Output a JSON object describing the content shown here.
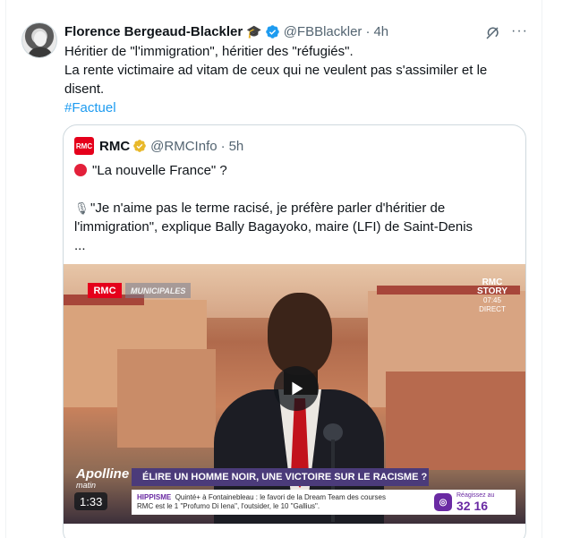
{
  "tweet": {
    "author_name": "Florence Bergeaud-Blackler",
    "author_emoji": "🎓",
    "handle": "@FBBlackler",
    "separator": "·",
    "time": "4h",
    "lines": [
      "Héritier de \"l'immigration\", héritier des \"réfugiés\".",
      "La rente victimaire ad vitam de ceux qui ne veulent pas s'assimiler et le",
      "disent."
    ],
    "hashtag": "#Factuel",
    "more_label": "···"
  },
  "quoted": {
    "logo_text": "RMC",
    "name": "RMC",
    "handle": "@RMCInfo",
    "separator": "·",
    "time": "5h",
    "line1": "\"La nouvelle France\" ?",
    "line2": "\"Je n'aime pas le terme racisé, je préfère parler d'héritier de",
    "line3": "l'immigration\", explique Bally Bagayoko, maire (LFI) de Saint-Denis",
    "line4": "..."
  },
  "video": {
    "channel_badge": "RMC",
    "show_badge": "MUNICIPALES",
    "story_line1": "RMC",
    "story_line2": "STORY",
    "story_time": "07:45",
    "story_live": "DIRECT",
    "show_name": "Apolline",
    "show_sub": "matin",
    "headline": "ÉLIRE UN HOMME NOIR, UNE VICTOIRE SUR LE RACISME ?",
    "ticker_label": "HIPPISME",
    "ticker_line1": "Quinté+ à Fontainebleau : le favori de la Dream Team des courses",
    "ticker_line2": "RMC est le 1 \"Profumo Di Iena\", l'outsider, le 10 \"Gallius\".",
    "score_label": "Réagissez au",
    "score_number": "32 16",
    "duration": "1:33"
  },
  "colors": {
    "link": "#1d9bf0",
    "verified": "#1d9bf0",
    "gold_badge": "#e8b82a",
    "rmc_red": "#e5001b",
    "banner_purple": "#4b3b7a"
  }
}
